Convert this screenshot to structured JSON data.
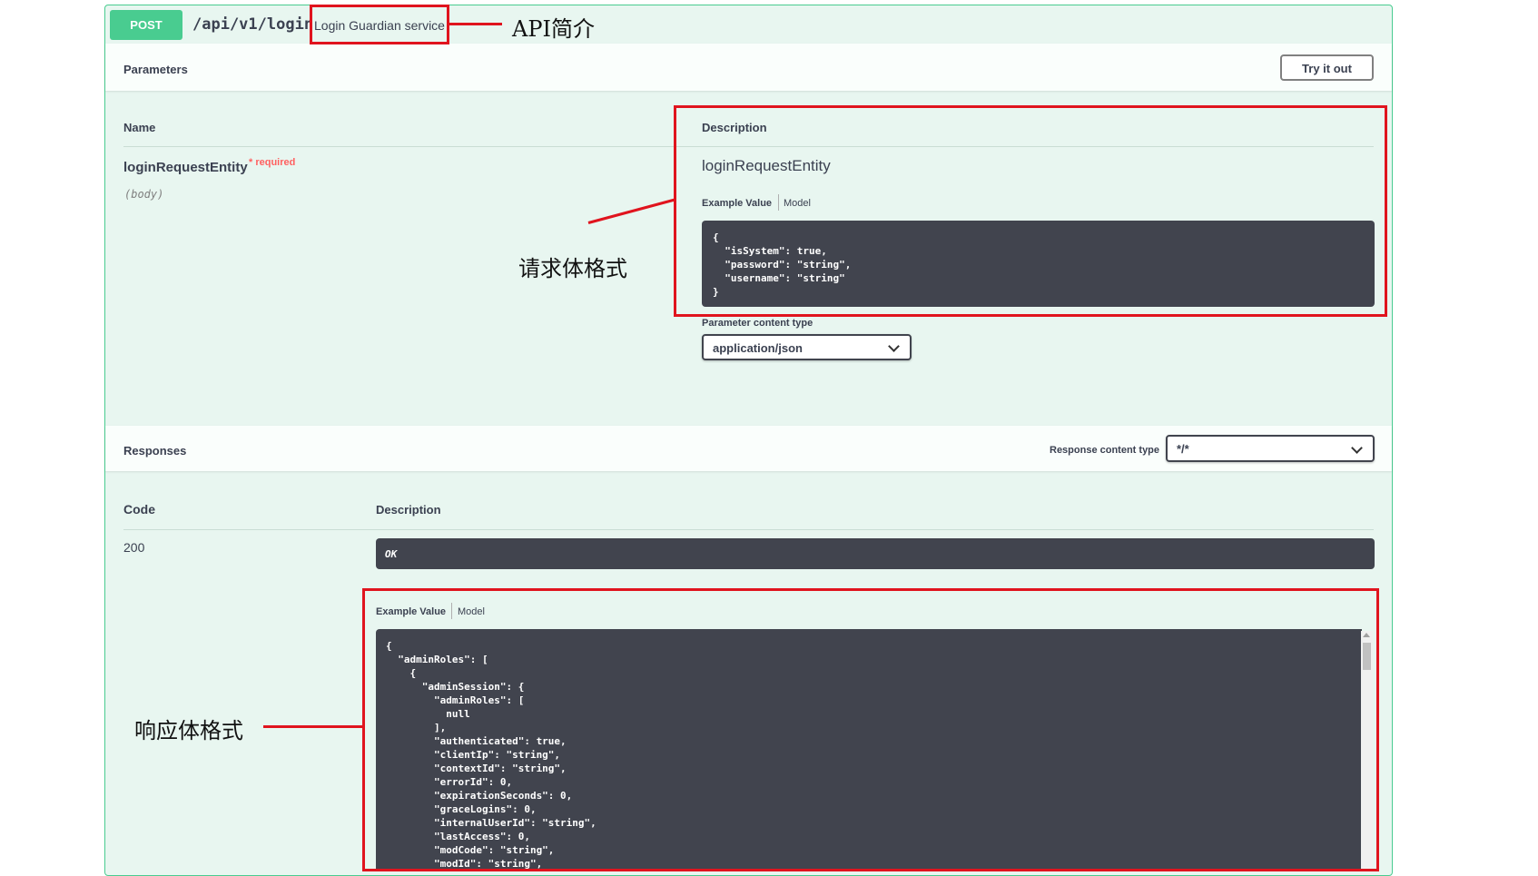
{
  "endpoint": {
    "method": "POST",
    "path": "/api/v1/login",
    "summary": "Login Guardian service"
  },
  "parameters": {
    "title": "Parameters",
    "try_button": "Try it out",
    "col_name": "Name",
    "col_description": "Description",
    "param": {
      "name": "loginRequestEntity",
      "required_marker": "*",
      "required_label": "required",
      "location": "(body)",
      "model_name": "loginRequestEntity",
      "tab_example": "Example Value",
      "tab_model": "Model",
      "example_json": "{\n  \"isSystem\": true,\n  \"password\": \"string\",\n  \"username\": \"string\"\n}",
      "content_type_label": "Parameter content type",
      "content_type_value": "application/json"
    }
  },
  "responses": {
    "title": "Responses",
    "content_type_label": "Response content type",
    "content_type_value": "*/*",
    "col_code": "Code",
    "col_description": "Description",
    "code": "200",
    "description": "OK",
    "tab_example": "Example Value",
    "tab_model": "Model",
    "example_json": "{\n  \"adminRoles\": [\n    {\n      \"adminSession\": {\n        \"adminRoles\": [\n          null\n        ],\n        \"authenticated\": true,\n        \"clientIp\": \"string\",\n        \"contextId\": \"string\",\n        \"errorId\": 0,\n        \"expirationSeconds\": 0,\n        \"graceLogins\": 0,\n        \"internalUserId\": \"string\",\n        \"lastAccess\": 0,\n        \"modCode\": \"string\",\n        \"modId\": \"string\","
  },
  "annotations": {
    "api_intro": "API简介",
    "request_format": "请求体格式",
    "response_format": "响应体格式"
  },
  "colors": {
    "post_green": "#49cc90",
    "annotation_red": "#e0141e",
    "code_bg": "#41444e"
  }
}
